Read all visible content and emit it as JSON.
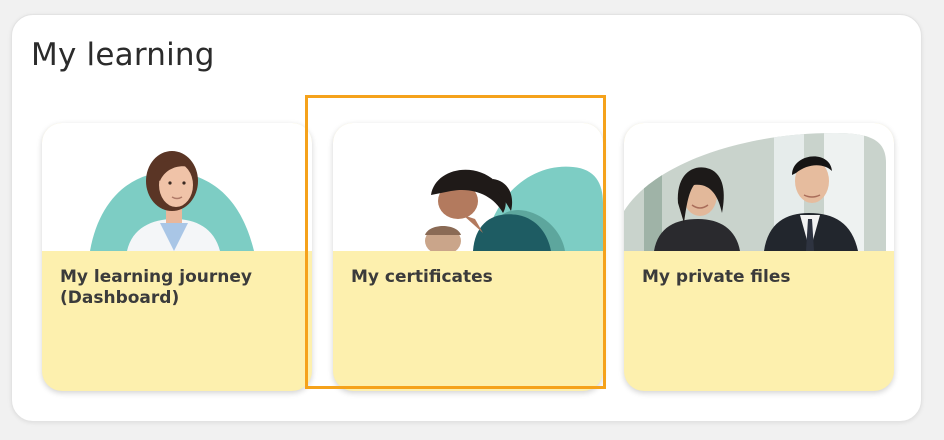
{
  "page_title": "My learning",
  "cards": [
    {
      "label": "My learning journey (Dashboard)",
      "image": "doctor-photo"
    },
    {
      "label": "My certificates",
      "image": "caregiver-photo"
    },
    {
      "label": "My private files",
      "image": "business-people-photo"
    }
  ],
  "focused_card": 1,
  "colors": {
    "card_background": "#fdf0ae",
    "accent_teal": "#7dcdc4",
    "focus_outline": "#f5a21b",
    "text": "#3b3b3b"
  }
}
